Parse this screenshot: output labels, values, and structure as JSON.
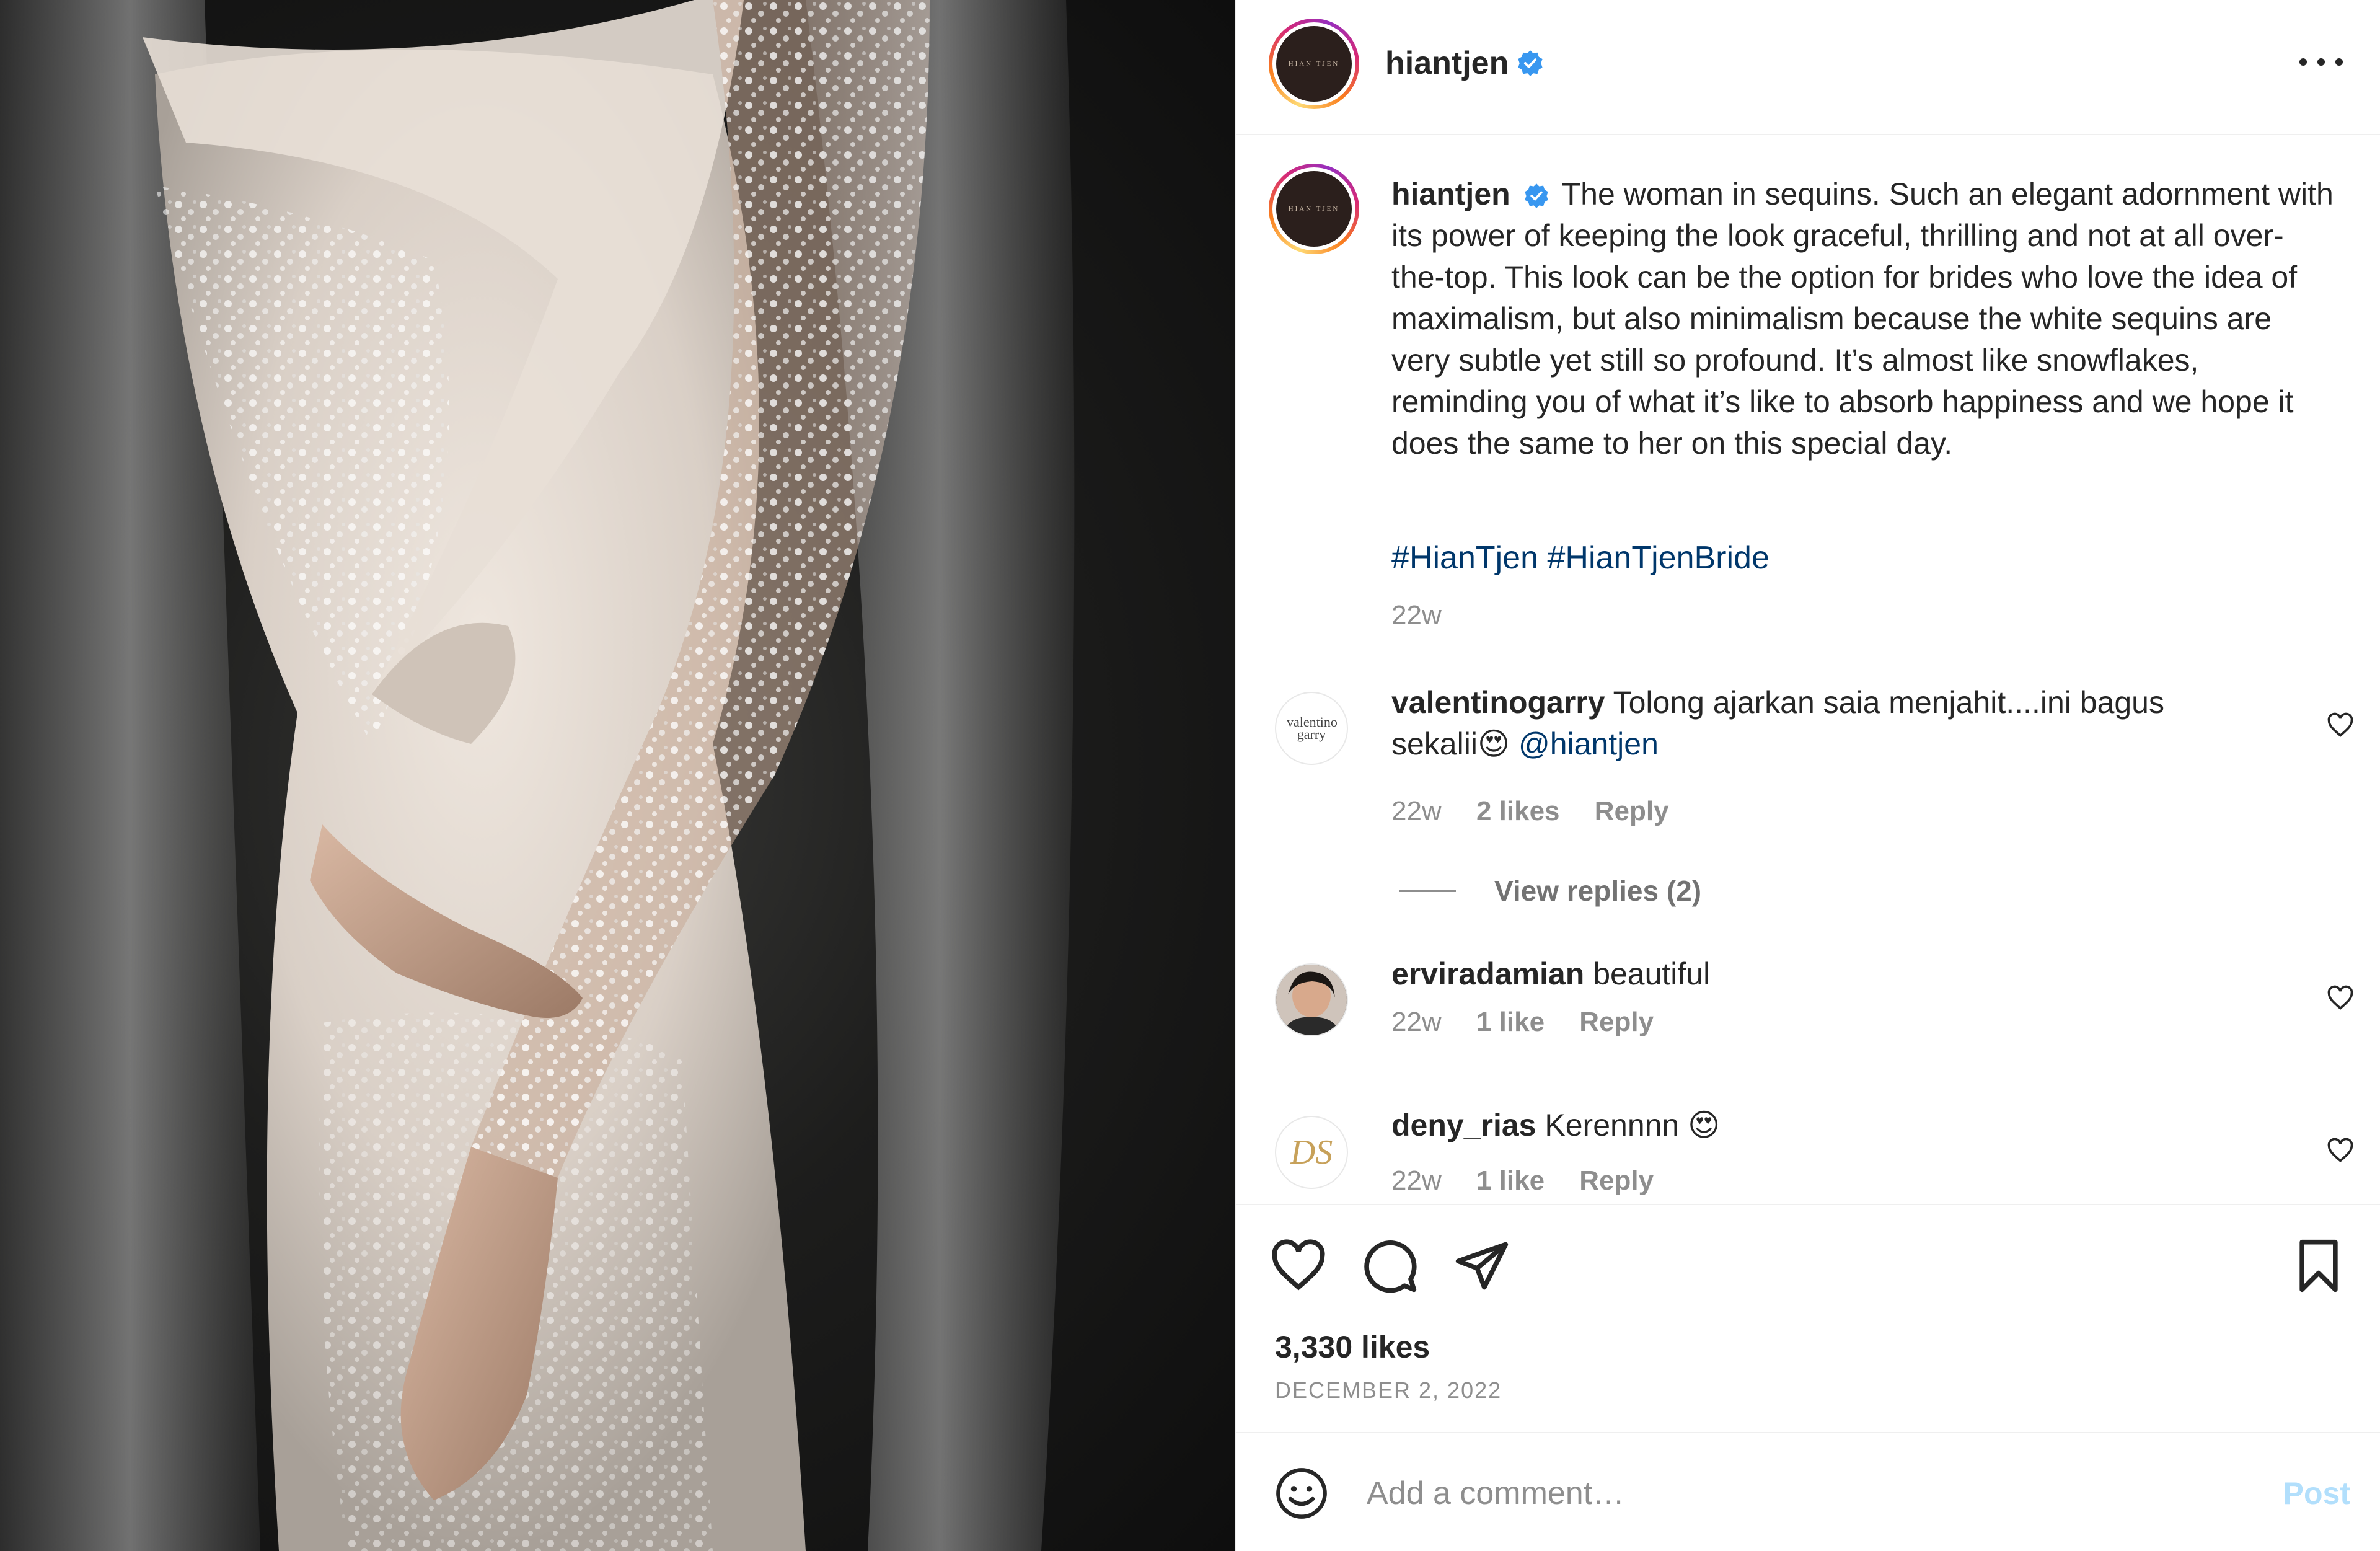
{
  "post": {
    "username": "hiantjen",
    "avatar_text": "HIAN TJEN",
    "caption": "The woman in sequins. Such an elegant adornment with its power of keeping the look graceful, thrilling and not at all over-the-top. This look can be the option for brides who love the idea of maximalism, but also minimalism because the white sequins are very subtle yet still so profound. It’s almost like snowflakes, reminding you of what it’s like to absorb happiness and we hope it does the same to her on this special day.",
    "hashtags": "#HianTjen #HianTjenBride",
    "caption_age": "22w",
    "likes": "3,330 likes",
    "date": "DECEMBER 2, 2022"
  },
  "comments": [
    {
      "username": "valentinogarry",
      "text": "Tolong ajarkan saia menjahit....ini bagus sekalii😍",
      "mention": "@hiantjen",
      "age": "22w",
      "likes": "2 likes",
      "reply": "Reply",
      "avatar_text": "valentino garry"
    },
    {
      "username": "erviradamian",
      "text": "beautiful",
      "age": "22w",
      "likes": "1 like",
      "reply": "Reply"
    },
    {
      "username": "deny_rias",
      "text": "Kerennnn 😍",
      "age": "22w",
      "likes": "1 like",
      "reply": "Reply",
      "avatar_text": "DS"
    }
  ],
  "view_replies": "View replies (2)",
  "add_comment": {
    "placeholder": "Add a comment…",
    "post_label": "Post"
  },
  "colors": {
    "link": "#00376b",
    "muted": "#8e8e8e",
    "post_disabled": "#b2dffc",
    "verified": "#3897f0"
  },
  "icons": [
    "more-icon",
    "verified-icon",
    "heart-icon",
    "comment-icon",
    "share-icon",
    "bookmark-icon",
    "emoji-icon"
  ]
}
